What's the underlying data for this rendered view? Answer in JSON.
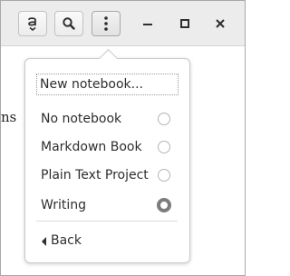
{
  "headerbar": {
    "icons": {
      "notebook_button": "notebook-icon",
      "search_button": "search-icon",
      "menu_button": "vertical-ellipsis-icon",
      "minimize": "minimize-icon",
      "maximize": "maximize-icon",
      "close": "close-icon"
    }
  },
  "background": {
    "text_fragment": "ns"
  },
  "popover": {
    "new_notebook_label": "New notebook...",
    "items": [
      {
        "label": "No notebook",
        "selected": false
      },
      {
        "label": "Markdown Book",
        "selected": false
      },
      {
        "label": "Plain Text Project",
        "selected": false
      },
      {
        "label": "Writing",
        "selected": true
      }
    ],
    "back_label": "Back",
    "back_icon": "back-arrow-icon"
  },
  "colors": {
    "headerbar_bg": "#ececec",
    "popover_border": "#c9c9c9",
    "text": "#2e2e2e",
    "radio_checked": "#7c7c7c"
  }
}
